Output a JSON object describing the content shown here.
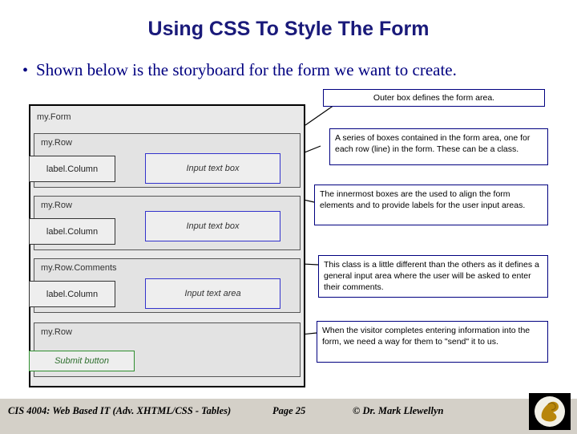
{
  "slide": {
    "title": "Using CSS To Style The Form",
    "bullet": {
      "marker": "•",
      "text": "Shown below is the storyboard for the form we want to create."
    }
  },
  "storyboard": {
    "outer_label": "my.Form",
    "rows": [
      {
        "row_label": "my.Row",
        "label_column": "label.Column",
        "input": "Input text box"
      },
      {
        "row_label": "my.Row",
        "label_column": "label.Column",
        "input": "Input text box"
      },
      {
        "row_label": "my.Row.Comments",
        "label_column": "label.Column",
        "input": "Input text area"
      },
      {
        "row_label": "my.Row",
        "submit": "Submit button"
      }
    ]
  },
  "callouts": [
    {
      "name": "outer-box-note",
      "text": "Outer box defines the form area."
    },
    {
      "name": "rows-note",
      "text": "A series of boxes contained in the form area, one for each row (line) in the form.  These can be a class."
    },
    {
      "name": "innermost-note",
      "text": "The innermost boxes are the used to align the form elements and to provide labels for the user input areas."
    },
    {
      "name": "comments-note",
      "text": "This class is a little different than the others as it defines a general input area where the user will be asked to enter their comments."
    },
    {
      "name": "submit-note",
      "text": "When the visitor completes entering information into the form, we need a way for them to \"send\" it to us."
    }
  ],
  "footer": {
    "course": "CIS 4004: Web Based IT (Adv. XHTML/CSS - Tables)",
    "page": "Page 25",
    "author": "© Dr. Mark Llewellyn"
  },
  "colors": {
    "title": "#1a1a7a",
    "bullet_text": "#000080",
    "callout_border": "#000080",
    "input_border": "#3333cc",
    "submit_border": "#2f8f2f",
    "footer_bg": "#d4d0c8"
  }
}
